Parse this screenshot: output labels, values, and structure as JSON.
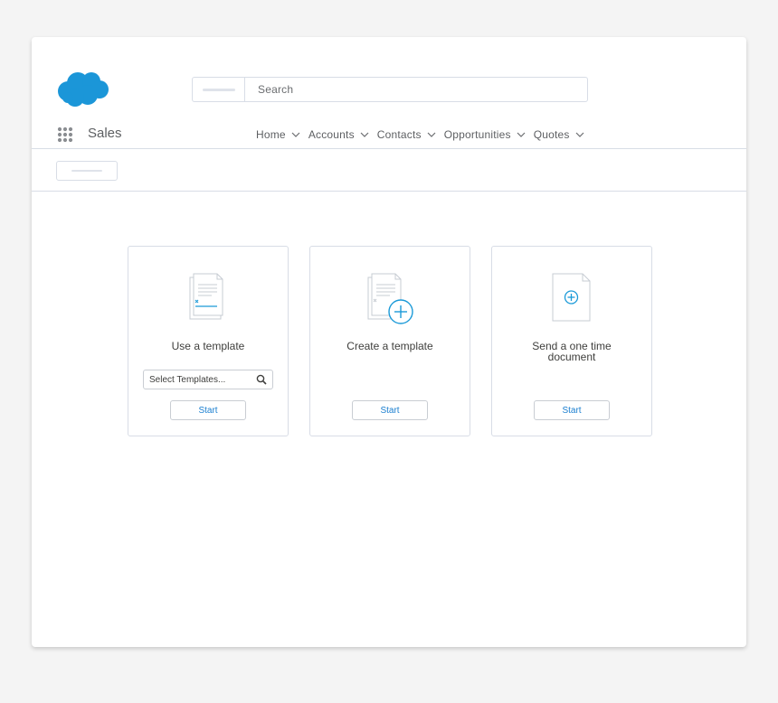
{
  "header": {
    "logo": "salesforce-cloud-logo",
    "search": {
      "placeholder": "Search"
    }
  },
  "app": {
    "name": "Sales",
    "nav": [
      {
        "label": "Home"
      },
      {
        "label": "Accounts"
      },
      {
        "label": "Contacts"
      },
      {
        "label": "Opportunities"
      },
      {
        "label": "Quotes"
      }
    ]
  },
  "cards": [
    {
      "title": "Use a template",
      "select_placeholder": "Select Templates...",
      "button": "Start",
      "icon": "template-document-icon"
    },
    {
      "title": "Create a template",
      "button": "Start",
      "icon": "create-template-icon"
    },
    {
      "title": "Send a one time document",
      "button": "Start",
      "icon": "one-time-document-icon"
    }
  ],
  "colors": {
    "brand": "#1b96d8",
    "accent": "#1b9ad8",
    "border": "#d8dde6",
    "background": "#f4f4f4"
  }
}
